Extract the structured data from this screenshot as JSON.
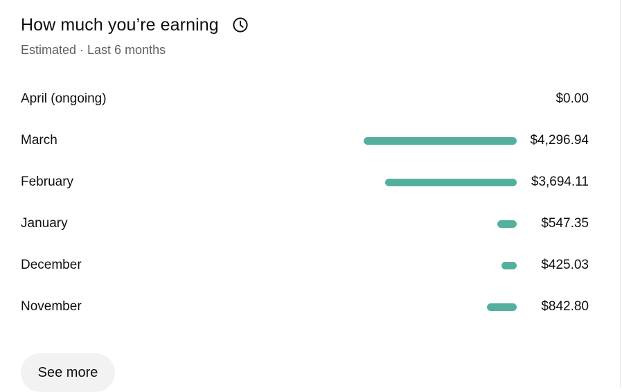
{
  "card": {
    "title": "How much you’re earning",
    "subtitle": "Estimated · Last 6 months",
    "history_icon": "clock-icon",
    "see_more_label": "See more"
  },
  "colors": {
    "bar": "#54b09e",
    "text": "#0f0f0f",
    "muted": "#606060",
    "button_bg": "#f2f2f2"
  },
  "chart_data": {
    "type": "bar",
    "categories": [
      "April (ongoing)",
      "March",
      "February",
      "January",
      "December",
      "November"
    ],
    "values": [
      0.0,
      4296.94,
      3694.11,
      547.35,
      425.03,
      842.8
    ],
    "value_labels": [
      "$0.00",
      "$4,296.94",
      "$3,694.11",
      "$547.35",
      "$425.03",
      "$842.80"
    ]
  }
}
